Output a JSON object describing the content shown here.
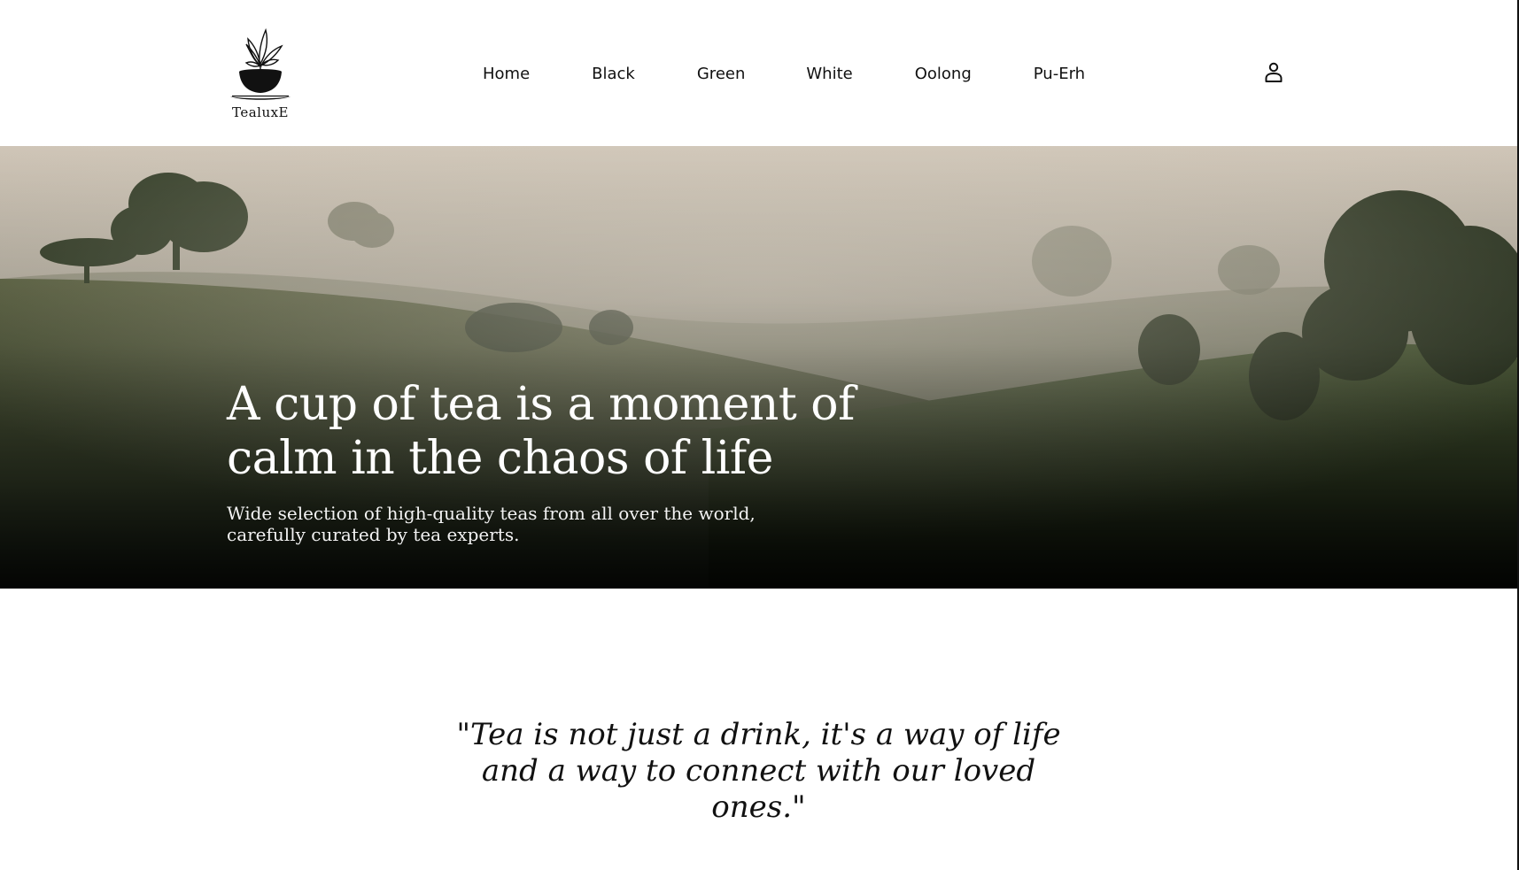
{
  "brand": {
    "name": "TealuxE",
    "logo_icon": "tea-cup-leaves-icon"
  },
  "nav": {
    "items": [
      {
        "label": "Home"
      },
      {
        "label": "Black"
      },
      {
        "label": "Green"
      },
      {
        "label": "White"
      },
      {
        "label": "Oolong"
      },
      {
        "label": "Pu-Erh"
      }
    ]
  },
  "header": {
    "account_icon": "user-account-icon"
  },
  "hero": {
    "title": "A cup of tea is a moment of calm in the chaos of life",
    "subtitle": "Wide selection of high-quality teas from all over the world, carefully curated by tea experts.",
    "image_subject": "misty tea plantation hills"
  },
  "quote": {
    "text": "\"Tea is not just a drink, it's a way of life and a way to connect with our loved ones.\""
  },
  "colors": {
    "background": "#ffffff",
    "text": "#111111",
    "hero_text": "#ffffff",
    "hero_sky": "#cfc5b7",
    "hero_foliage": "#34442a"
  }
}
